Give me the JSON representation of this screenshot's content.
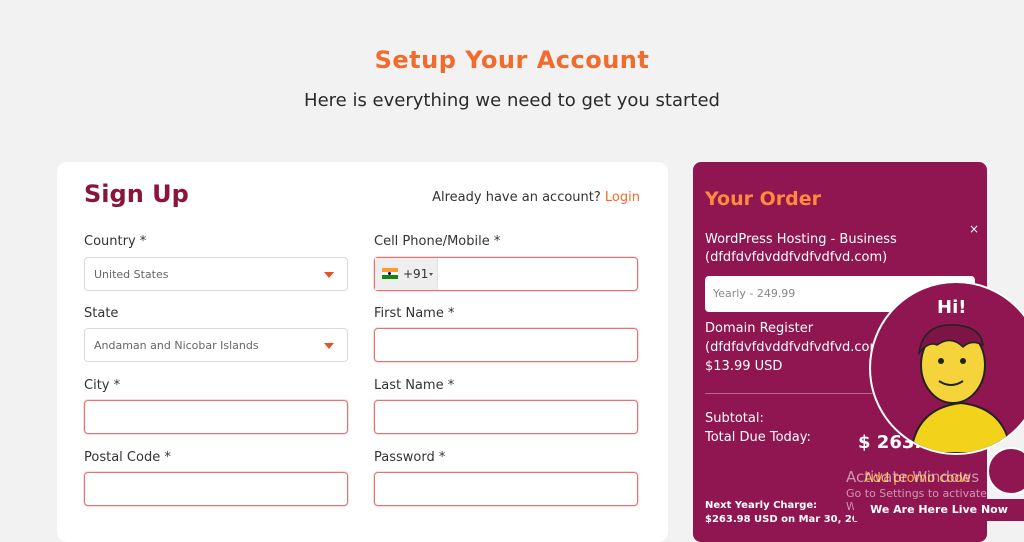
{
  "header": {
    "title": "Setup Your Account",
    "subtitle": "Here is everything we need to get you started"
  },
  "signup": {
    "title": "Sign Up",
    "account_prompt": "Already have an account?",
    "login_label": "Login",
    "fields": {
      "country": {
        "label": "Country *",
        "value": "United States"
      },
      "phone": {
        "label": "Cell Phone/Mobile *",
        "dial_code": "+91",
        "value": ""
      },
      "state": {
        "label": "State",
        "value": "Andaman and Nicobar Islands"
      },
      "first_name": {
        "label": "First Name *",
        "value": ""
      },
      "city": {
        "label": "City *",
        "value": ""
      },
      "last_name": {
        "label": "Last Name *",
        "value": ""
      },
      "postal_code": {
        "label": "Postal Code *",
        "value": ""
      },
      "password": {
        "label": "Password *",
        "value": ""
      }
    }
  },
  "order": {
    "title": "Your Order",
    "close_label": "×",
    "item1_name": "WordPress Hosting - Business",
    "item1_domain": "(dfdfdvfdvddfvdfvdfvd.com)",
    "billing_cycle": "Yearly - 249.99",
    "item2_name": "Domain Register",
    "item2_domain": "(dfdfdvfdvddfvdfvdfvd.com",
    "item2_price": "$13.99 USD",
    "subtotal_label": "Subtotal:",
    "total_label": "Total Due Today:",
    "total_amount": "$ 263.98",
    "promo_label": "Add promo code",
    "next_charge_label": "Next Yearly Charge:",
    "next_charge_value": "$263.98 USD on Mar 30, 20"
  },
  "chat": {
    "greeting": "Hi!",
    "banner": "We Are Here Live Now"
  },
  "watermark": {
    "line1": "Activate Windows",
    "line2": "Go to Settings to activate Windows"
  },
  "colors": {
    "accent": "#f26a2c",
    "brand": "#8f1650",
    "signup_title": "#8a1538"
  }
}
